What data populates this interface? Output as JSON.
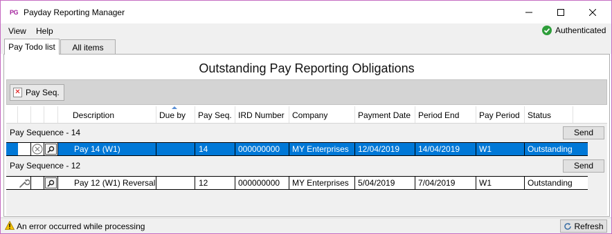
{
  "window": {
    "logo": "PG",
    "title": "Payday Reporting Manager",
    "accent_border": "#c46ac2"
  },
  "menu": {
    "view": "View",
    "help": "Help"
  },
  "auth": {
    "label": "Authenticated",
    "status_color": "#2e9e3a",
    "icon": "check-circle-icon"
  },
  "tabs": [
    {
      "label": "Pay Todo list",
      "active": true
    },
    {
      "label": "All items",
      "active": false
    }
  ],
  "main": {
    "heading": "Outstanding Pay Reporting Obligations",
    "group_chip": "Pay Seq."
  },
  "grid": {
    "columns": [
      "Description",
      "Due by",
      "Pay Seq.",
      "IRD Number",
      "Company",
      "Payment Date",
      "Period End",
      "Pay Period",
      "Status"
    ],
    "groups": [
      {
        "label": "Pay Sequence - 14",
        "send": "Send",
        "row": {
          "selected": true,
          "description": "Pay 14 (W1)",
          "due_by": "",
          "pay_seq": "14",
          "ird": "000000000",
          "company": "MY Enterprises",
          "payment_date": "12/04/2019",
          "period_end": "14/04/2019",
          "pay_period": "W1",
          "status": "Outstanding"
        }
      },
      {
        "label": "Pay Sequence - 12",
        "send": "Send",
        "row": {
          "selected": false,
          "description": "Pay 12 (W1) Reversal",
          "due_by": "",
          "pay_seq": "12",
          "ird": "000000000",
          "company": "MY Enterprises",
          "payment_date": "5/04/2019",
          "period_end": "7/04/2019",
          "pay_period": "W1",
          "status": "Outstanding"
        }
      }
    ],
    "selection_color": "#0078d7"
  },
  "status": {
    "message": "An error occurred while processing",
    "refresh": "Refresh"
  }
}
